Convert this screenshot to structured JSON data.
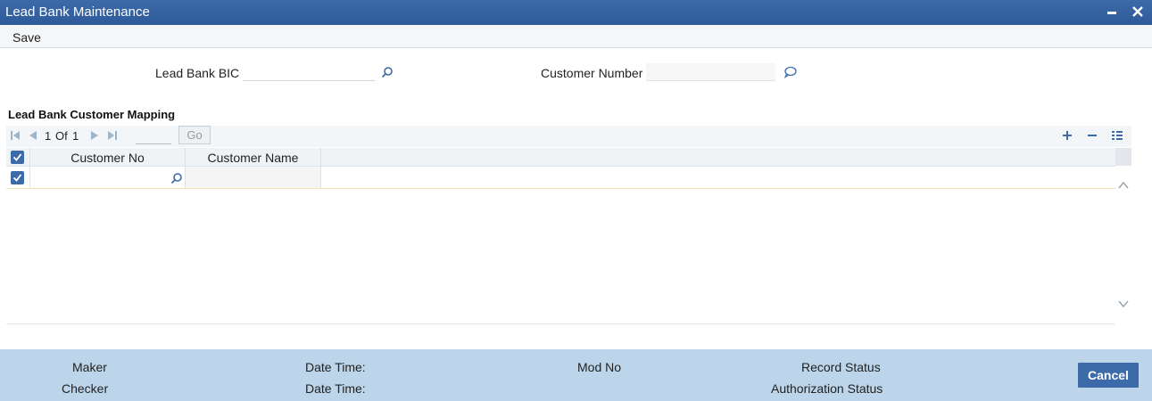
{
  "window": {
    "title": "Lead Bank Maintenance"
  },
  "menu": {
    "save_label": "Save"
  },
  "form": {
    "lead_bank_bic_label": "Lead Bank BIC",
    "lead_bank_bic_value": "",
    "customer_number_label": "Customer Number",
    "customer_number_value": ""
  },
  "section": {
    "title": "Lead Bank Customer Mapping"
  },
  "pager": {
    "current": "1",
    "of_label": "Of",
    "total": "1",
    "go_label": "Go"
  },
  "grid": {
    "columns": [
      "Customer No",
      "Customer Name"
    ],
    "rows": [
      {
        "checked": true,
        "customer_no": "",
        "customer_name": ""
      }
    ]
  },
  "footer": {
    "maker_label": "Maker",
    "checker_label": "Checker",
    "date_time_label_1": "Date Time:",
    "date_time_label_2": "Date Time:",
    "mod_no_label": "Mod No",
    "record_status_label": "Record Status",
    "authorization_status_label": "Authorization Status",
    "cancel_label": "Cancel"
  },
  "colors": {
    "accent": "#3d6aa8",
    "footer_bg": "#bcd5ea"
  },
  "icons": [
    "minimize-icon",
    "close-icon",
    "search-icon",
    "chat-icon",
    "first-page-icon",
    "prev-page-icon",
    "next-page-icon",
    "last-page-icon",
    "add-row-icon",
    "delete-row-icon",
    "column-list-icon",
    "checkbox-icon",
    "scroll-up-icon",
    "scroll-down-icon"
  ]
}
